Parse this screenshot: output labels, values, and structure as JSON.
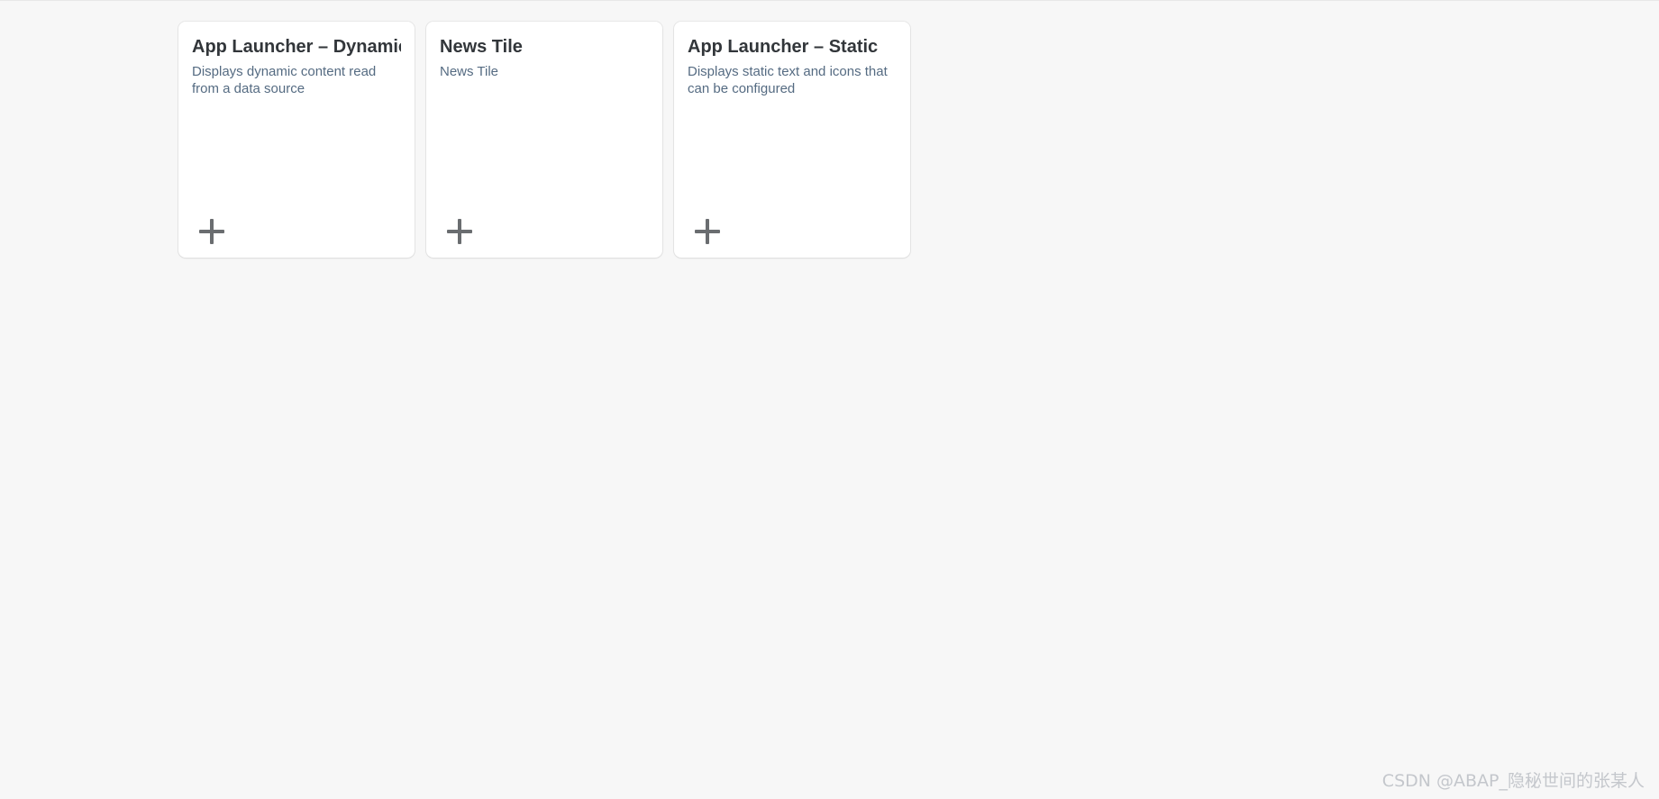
{
  "tiles": [
    {
      "title": "App Launcher – Dynamic",
      "subtitle": "Displays dynamic content read from a data source",
      "icon": "plus-icon"
    },
    {
      "title": "News Tile",
      "subtitle": "News Tile",
      "icon": "plus-icon"
    },
    {
      "title": "App Launcher – Static",
      "subtitle": "Displays static text and icons that can be configured",
      "icon": "plus-icon"
    }
  ],
  "watermark": "CSDN @ABAP_隐秘世间的张某人",
  "colors": {
    "background": "#f7f7f7",
    "tile": "#ffffff",
    "title": "#32363a",
    "subtitle": "#556b82",
    "icon": "#6a6d70"
  }
}
